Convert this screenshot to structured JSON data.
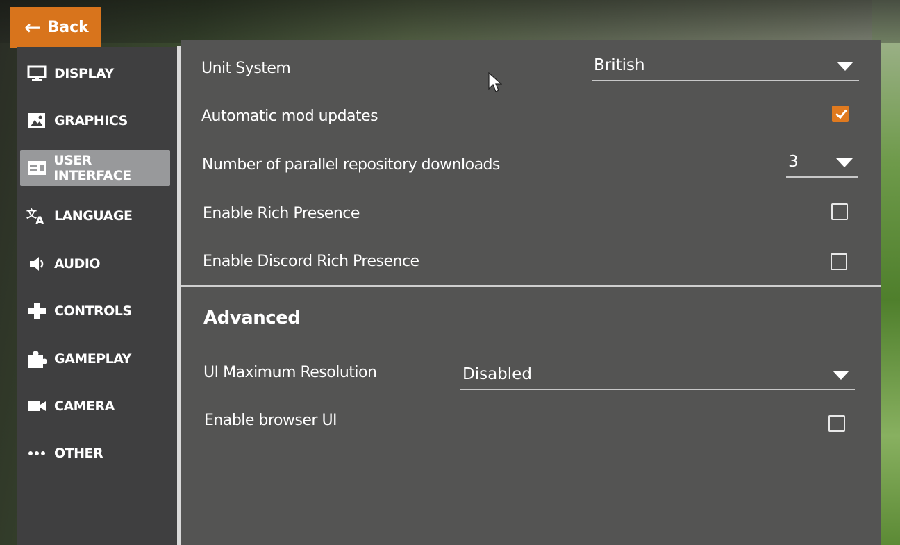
{
  "back_button": {
    "label": "Back"
  },
  "sidebar": {
    "items": [
      {
        "label": "DISPLAY",
        "icon": "monitor-icon",
        "active": false
      },
      {
        "label": "GRAPHICS",
        "icon": "image-icon",
        "active": false
      },
      {
        "label": "USER INTERFACE",
        "icon": "user-interface-icon",
        "active": true
      },
      {
        "label": "LANGUAGE",
        "icon": "translate-icon",
        "active": false
      },
      {
        "label": "AUDIO",
        "icon": "speaker-icon",
        "active": false
      },
      {
        "label": "CONTROLS",
        "icon": "gamepad-icon",
        "active": false
      },
      {
        "label": "GAMEPLAY",
        "icon": "puzzle-icon",
        "active": false
      },
      {
        "label": "CAMERA",
        "icon": "camera-icon",
        "active": false
      },
      {
        "label": "OTHER",
        "icon": "more-icon",
        "active": false
      }
    ]
  },
  "settings": {
    "unit_system": {
      "label": "Unit System",
      "value": "British"
    },
    "auto_mod_updates": {
      "label": "Automatic mod updates",
      "checked": true
    },
    "parallel_downloads": {
      "label": "Number of parallel repository downloads",
      "value": "3"
    },
    "rich_presence": {
      "label": "Enable Rich Presence",
      "checked": false
    },
    "discord_rich_presence": {
      "label": "Enable Discord Rich Presence",
      "checked": false
    }
  },
  "advanced": {
    "title": "Advanced",
    "ui_max_resolution": {
      "label": "UI Maximum Resolution",
      "value": "Disabled"
    },
    "browser_ui": {
      "label": "Enable browser UI",
      "checked": false
    }
  },
  "colors": {
    "accent": "#e07a1f",
    "panel": "#545453",
    "sidebar": "#3f3f40",
    "active_item": "#98999b"
  }
}
